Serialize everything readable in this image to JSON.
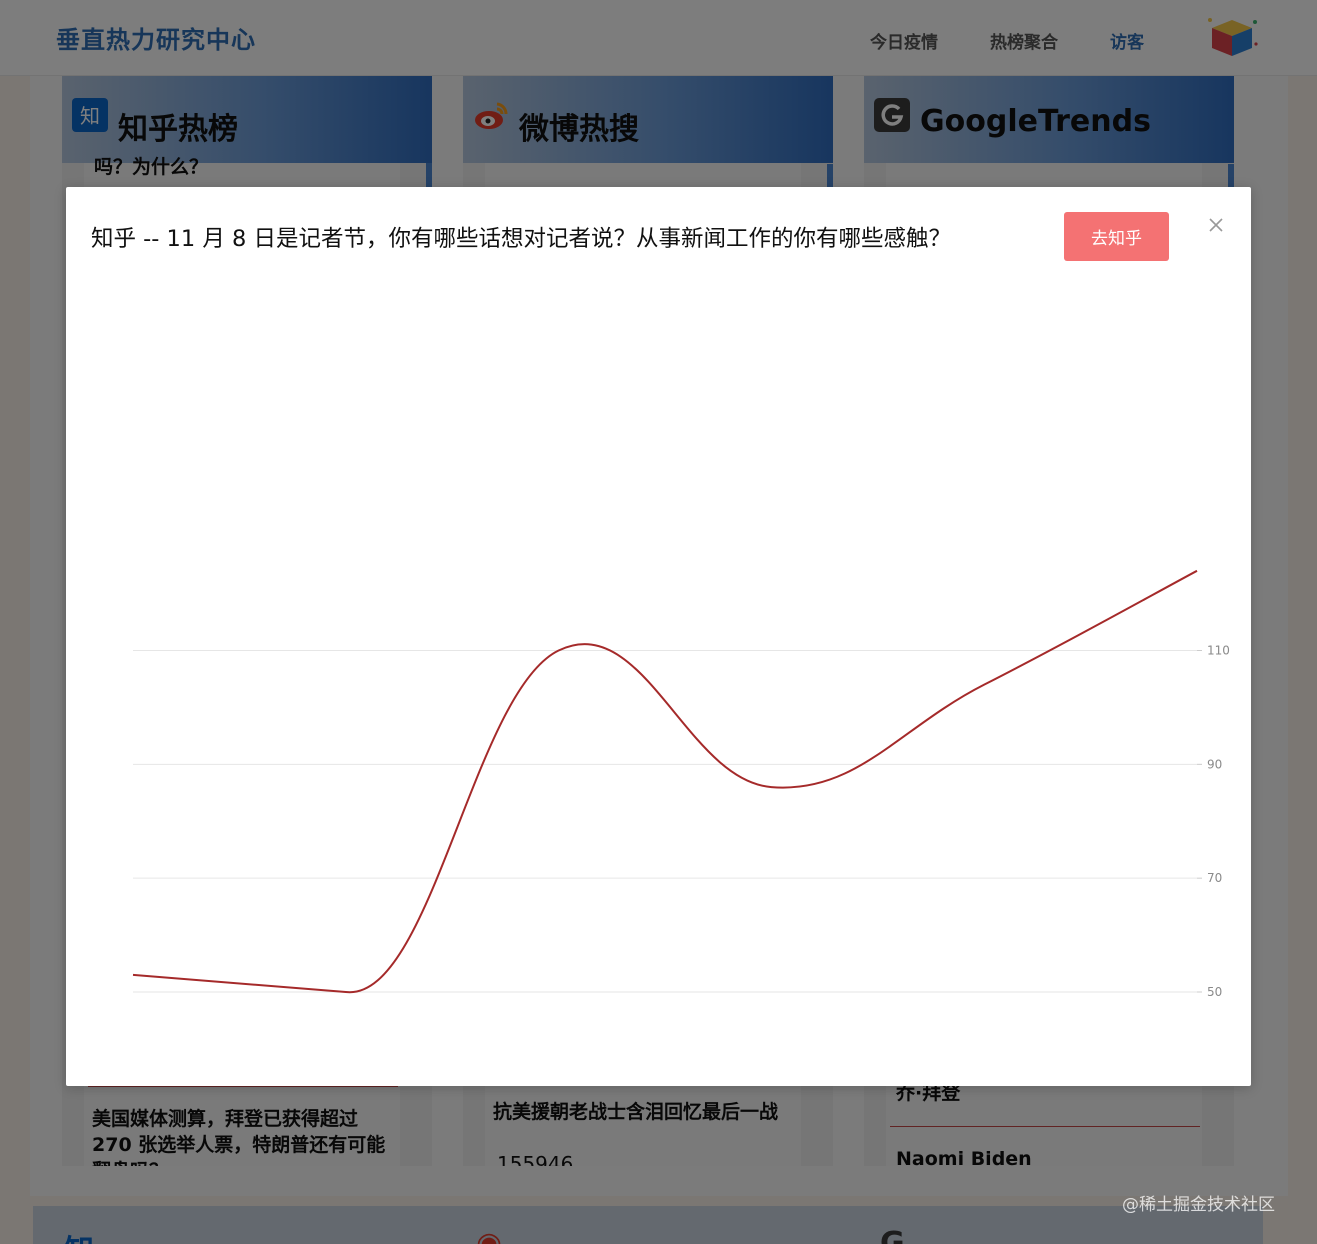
{
  "header": {
    "brand": "垂直热力研究中心",
    "nav": [
      "今日疫情",
      "热榜聚合",
      "访客"
    ]
  },
  "cards": [
    {
      "title": "知乎热榜",
      "icon": "zhihu-icon",
      "icon_text": "知"
    },
    {
      "title": "微博热搜",
      "icon": "weibo-icon"
    },
    {
      "title": "GoogleTrends",
      "icon": "google-icon"
    }
  ],
  "card_snippets": {
    "zhihu_top": "吗？为什么？",
    "zhihu_bottom": "美国媒体测算，拜登已获得超过 270 张选举人票，特朗普还有可能翻盘吗？",
    "weibo_bottom": "抗美援朝老战士含泪回忆最后一战",
    "weibo_count": "155946",
    "google_bottom_1": "乔·拜登",
    "google_bottom_2": "Naomi Biden"
  },
  "watermark": "@稀土掘金技术社区",
  "modal": {
    "title": "知乎 -- 11 月 8 日是记者节，你有哪些话想对记者说？从事新闻工作的你有哪些感触？",
    "button_label": "去知乎",
    "close_icon": "close-icon"
  },
  "chart_data": {
    "type": "line",
    "title": "",
    "xlabel": "",
    "ylabel": "",
    "y_axis_position": "right",
    "ylim": [
      40,
      130
    ],
    "yticks": [
      50,
      70,
      90,
      110
    ],
    "grid": true,
    "line_color": "#a52a2a",
    "x": [
      0,
      1,
      2,
      3,
      4,
      5
    ],
    "values": [
      53,
      50,
      110,
      86,
      104,
      124
    ]
  }
}
